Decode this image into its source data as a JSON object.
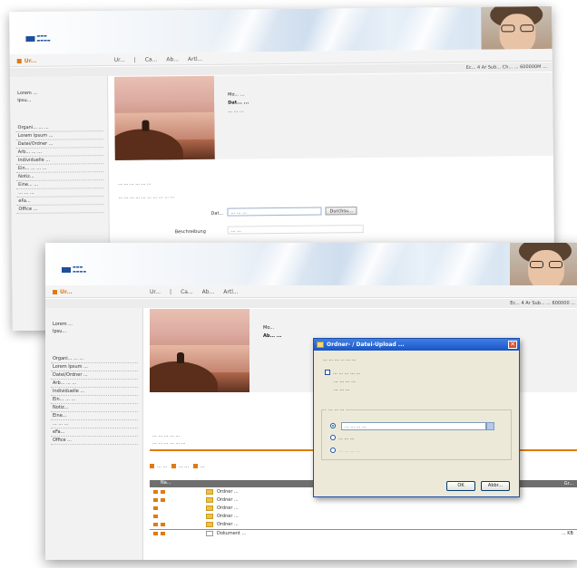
{
  "back_window": {
    "brand": "Ur...",
    "menu": [
      "Ur...",
      "|",
      "Ca...",
      "Ab...",
      "Artl..."
    ],
    "status_right": "Ec... 4 Ar Sub...   Ch... ...  600000M ...",
    "sidebar_who": [
      "Lorem ...",
      "Ipsu..."
    ],
    "sidebar_items": [
      "Organi... ... ...",
      "Lorem Ipsum ...",
      "Datei/Ordner ...",
      "Arb... ... ...",
      "Individuelle ...",
      "Ein... ... ... ...",
      "Notiz...",
      "Eine... ...",
      "... ... ...",
      "eFa...",
      "Office ..."
    ],
    "info_line1": "Mo... ...",
    "info_line2": "Dat... ...",
    "info_line3": "... ... ...",
    "text1": "... ... ... ... ... ...",
    "text2": "... ... ... ... ... ... ... ... ... ...",
    "form_label1": "Dat...",
    "form_input1": "... ... ...",
    "form_button": "Durchsu...",
    "form_label2": "Beschreibung",
    "form_input2": "... ..."
  },
  "front_window": {
    "brand": "Ur...",
    "menu": [
      "Ur...",
      "|",
      "Ca...",
      "Ab...",
      "Artl..."
    ],
    "status_right": "Ec... 4 Ar Sub... ... 600000 ...",
    "sidebar_who": [
      "Lorem ...",
      "Ipsu..."
    ],
    "sidebar_items": [
      "Organi... ... ...",
      "Lorem Ipsum ...",
      "Datei/Ordner ...",
      "Arb... ... ...",
      "Individuelle ...",
      "Ein... ... ...",
      "Notiz...",
      "Eine...",
      "... ... ...",
      "eFa...",
      "Office ..."
    ],
    "info_line1": "Mo...",
    "info_line2": "Ab... ...",
    "text1": "... ... ... ... ...",
    "text2": "... ... ... ... ... ...",
    "legend": [
      "... ...",
      "... ...",
      "..."
    ],
    "grid_header": "Na...",
    "grid_header_right": "Gr...",
    "grid_rows": [
      {
        "name": "Ordner ...",
        "size": ""
      },
      {
        "name": "Ordner ...",
        "size": ""
      },
      {
        "name": "Ordner ...",
        "size": ""
      },
      {
        "name": "Ordner ...",
        "size": ""
      },
      {
        "name": "Ordner ...",
        "size": ""
      },
      {
        "name": "Dokument ...",
        "size": "... KB"
      }
    ],
    "dialog": {
      "title": "Ordner- / Datei-Upload ...",
      "prompt": "... ... ... ... ... ...",
      "check_label": "... ... ... ... ...",
      "sub1": "... ... ... ...",
      "sub2": "... ... ...",
      "group_title": "... ... ...",
      "select_value": "... ... ... ...",
      "radio2": "... ... ...",
      "radio3": "... ... ... ...",
      "ok": "OK",
      "cancel": "Abbr..."
    }
  },
  "colors": {
    "accent_orange": "#e07a10",
    "dialog_title_blue": "#1a55c7",
    "logo_blue": "#1e4e9c"
  },
  "icons": [
    "logo-mark-icon",
    "folder-icon",
    "close-icon",
    "dropdown-arrow-icon",
    "checkbox-icon",
    "radio-icon"
  ]
}
